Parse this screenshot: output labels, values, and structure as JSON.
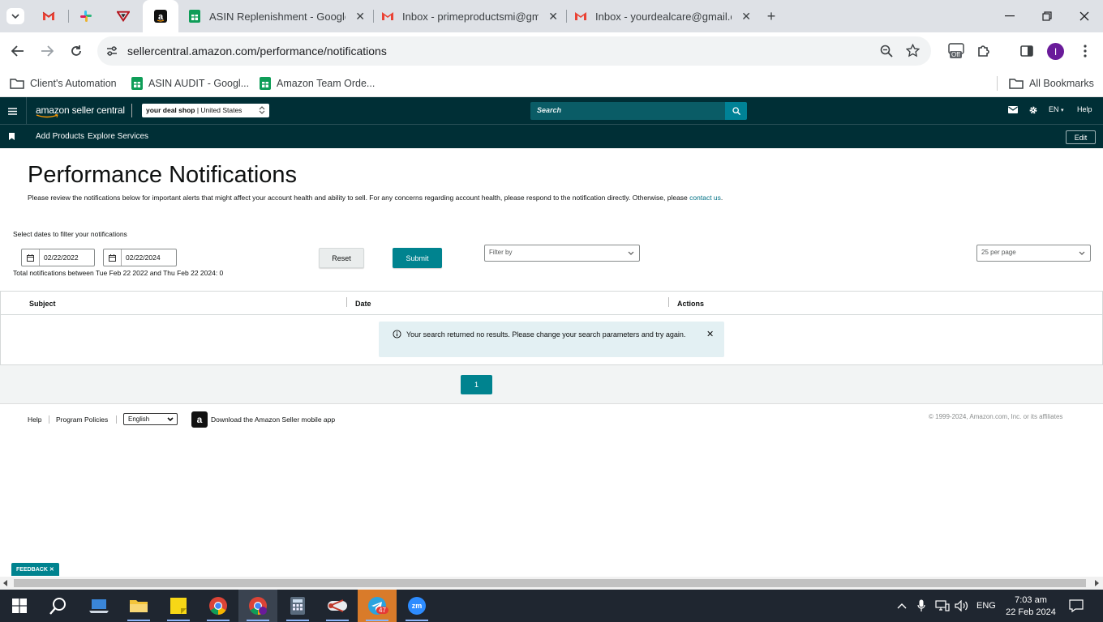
{
  "browser": {
    "tabs": [
      {
        "title": "ASIN Replenishment - Google S"
      },
      {
        "title": "Inbox - primeproductsmi@gma"
      },
      {
        "title": "Inbox - yourdealcare@gmail.co"
      }
    ],
    "url": "sellercentral.amazon.com/performance/notifications",
    "bookmarks": [
      {
        "label": "Client's Automation"
      },
      {
        "label": "ASIN AUDIT - Googl..."
      },
      {
        "label": "Amazon Team Orde..."
      }
    ],
    "all_bookmarks": "All Bookmarks",
    "extension_badge": "Off",
    "profile_initial": "I"
  },
  "header": {
    "logo": "amazon seller central",
    "store_name": "your deal shop",
    "store_region": "United States",
    "search_placeholder": "Search",
    "lang": "EN",
    "help": "Help"
  },
  "nav": {
    "links": [
      "Add Products",
      "Explore Services"
    ],
    "edit": "Edit"
  },
  "page": {
    "title": "Performance Notifications",
    "desc": "Please review the notifications below for important alerts that might affect your account health and ability to sell. For any concerns regarding account health, please respond to the notification directly. Otherwise, please",
    "contact_link": "contact us",
    "contact_after": ".",
    "filter_label": "Select dates to filter your notifications",
    "date_from": "02/22/2022",
    "date_to": "02/22/2024",
    "reset": "Reset",
    "submit": "Submit",
    "filter_by": "Filter by",
    "per_page": "25 per page",
    "total": "Total notifications between Tue Feb 22 2022 and Thu Feb 22 2024: 0",
    "columns": [
      "Subject",
      "Date",
      "Actions"
    ],
    "no_results": "Your search returned no results. Please change your search parameters and try again.",
    "page_number": "1"
  },
  "footer": {
    "help": "Help",
    "policies": "Program Policies",
    "language": "English",
    "app": "Download the Amazon Seller mobile app",
    "copyright": "© 1999-2024, Amazon.com, Inc. or its affiliates",
    "feedback": "FEEDBACK"
  },
  "taskbar": {
    "time": "7:03 am",
    "date": "22 Feb 2024",
    "lang": "ENG",
    "telegram_badge": "47"
  },
  "colors": {
    "teal_header": "#002f36",
    "submit": "#00838f",
    "alert_bg": "#e3f0f3",
    "link": "#007185"
  }
}
